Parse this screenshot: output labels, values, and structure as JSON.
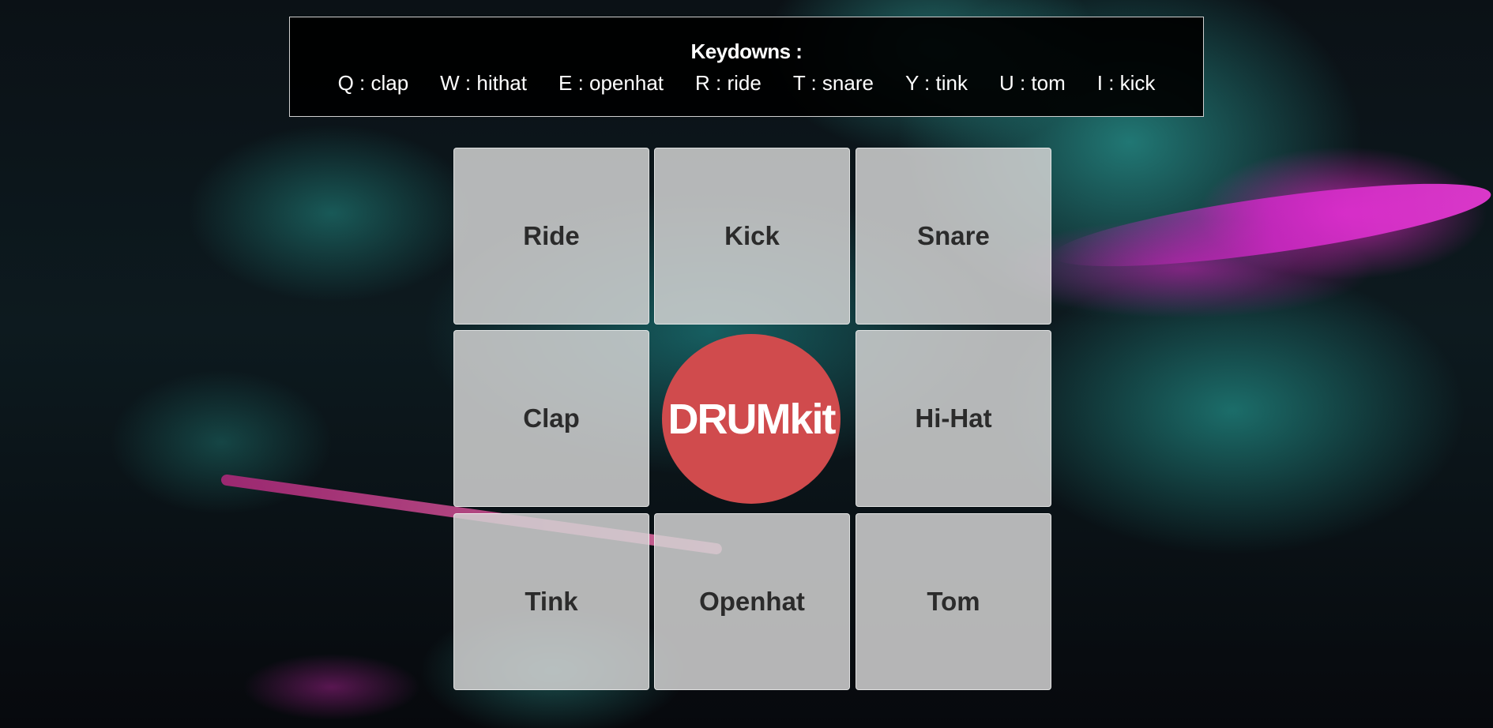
{
  "header": {
    "title": "Keydowns :",
    "keys": [
      "Q : clap",
      "W : hithat",
      "E : openhat",
      "R : ride",
      "T : snare",
      "Y : tink",
      "U : tom",
      "I : kick"
    ]
  },
  "pads": [
    "Ride",
    "Kick",
    "Snare",
    "Clap",
    "Hi-Hat",
    "Tink",
    "Openhat",
    "Tom"
  ],
  "logo": {
    "text": "DRUMkit",
    "color": "#d04b4d"
  },
  "colors": {
    "pad_background": "#d4d4d4",
    "pad_text": "#2b2b2b",
    "header_background": "#000000"
  }
}
